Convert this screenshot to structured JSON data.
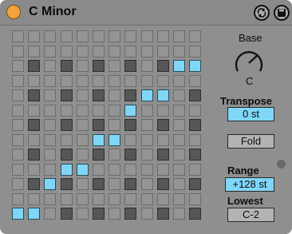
{
  "device": {
    "title": "C Minor",
    "accent": "#f2a43a",
    "icons": [
      "power-icon",
      "hot-swap-icon",
      "save-icon"
    ]
  },
  "grid": {
    "rows": 13,
    "cols": 12,
    "colors": {
      "off": "#949494",
      "scale_note": "#565656",
      "active": "#7fd6f7"
    },
    "scale_rows": [
      2,
      4,
      6,
      8,
      10,
      12
    ],
    "scale_cols": [
      1,
      3,
      5,
      7,
      9,
      11
    ],
    "active_cells": [
      [
        2,
        10
      ],
      [
        2,
        11
      ],
      [
        4,
        8
      ],
      [
        4,
        9
      ],
      [
        5,
        7
      ],
      [
        7,
        5
      ],
      [
        7,
        6
      ],
      [
        9,
        3
      ],
      [
        9,
        4
      ],
      [
        10,
        2
      ],
      [
        12,
        0
      ],
      [
        12,
        1
      ]
    ]
  },
  "controls": {
    "base": {
      "label": "Base",
      "value": "C"
    },
    "transpose": {
      "label": "Transpose",
      "value": "0 st"
    },
    "fold": {
      "label": "Fold"
    },
    "range": {
      "label": "Range",
      "value": "+128 st"
    },
    "lowest": {
      "label": "Lowest",
      "value": "C-2"
    }
  }
}
